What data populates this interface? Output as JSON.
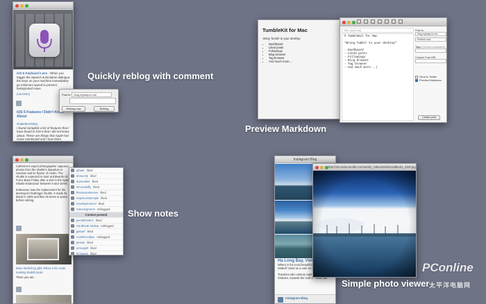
{
  "features": {
    "reblog": "Quickly reblog with comment",
    "markdown": "Preview Markdown",
    "notes": "Show notes",
    "photo": "Simple photo viewer"
  },
  "reblog_window": {
    "title": "",
    "post_text_1": "iOS 6 Keyboard Lens",
    "post_text_2": " - When you trigger the Speech & Dictation dialogue, the keys on your machine immediately go minimum speed to prevent background noise.",
    "via": "(via ishm)",
    "post2_title": "iOS 6 Features I Didn't Know About",
    "post2_author": "shakethemblog:",
    "post2_body": "I found compiled a list of features that I have found in iOS 6 that I did not know about. These are things that Apple has never mentioned and I love them.",
    "dialog": {
      "post_to_label": "Post to",
      "blog_value": "blog.myway.co.me",
      "reblog_select": "Reblog now",
      "reblog_button": "Reblog"
    }
  },
  "markdown_preview": {
    "title": "TumbleKit for Mac",
    "subtitle": "Bring Tumblr to your desktop",
    "items": [
      "Dashboard",
      "Liked posts",
      "Followings",
      "Blog browser",
      "Tag browser",
      "And much more..."
    ]
  },
  "markdown_editor": {
    "title_placeholder": "Title (optional)",
    "lines": [
      "# TumbleKit for Mac",
      "",
      "*Bring Tumblr to your desktop*",
      "",
      "- Dashboard",
      "- Liked posts",
      "- Followings",
      "- Blog browser",
      "- Tag browser",
      "- And much more...|"
    ],
    "post_to_label": "Post to",
    "blog_value": "blog.myway.co.me",
    "publish_value": "Publish now",
    "tags_label": "Tags",
    "tags_hint": "(Comma separated)",
    "url_label": "Custom Post URL",
    "send_twitter": "Send to Twitter",
    "preview_md": "Preview Markdown",
    "create_button": "Create post"
  },
  "notes_window": {
    "body_1": "Catherine's expert photographer captured photos from the shuttle's departure in Houston and its flyover of Austin. The shuttle is expected to land at Edwards Air Force Base Friday after a visit to the Space Shuttle Endeavour between 9 and 10AM.",
    "body_2": "Endeavour was the replacement for the destroyed Challenger shuttle. It made its debut in 1992 and flew 25 times in space before retiring.",
    "caption_1": "Bone Workshop gifts Yellow a fun scale, marking Reddit book!",
    "caption_2": "There you are.",
    "context_present": "Context present",
    "notes": [
      {
        "user": "gthaer",
        "action": "liked"
      },
      {
        "user": "dmsurely",
        "action": "liked"
      },
      {
        "user": "dunmarkie",
        "action": "liked"
      },
      {
        "user": "elmundotfly",
        "action": "liked"
      },
      {
        "user": "thenaturalresons",
        "action": "liked"
      },
      {
        "user": "mrpvlcuestiontyle",
        "action": "liked"
      },
      {
        "user": "newsbylemnovl",
        "action": "liked"
      },
      {
        "user": "missclegreens",
        "action": "reblogged"
      },
      {
        "user": "jacobhfosters",
        "action": "liked"
      },
      {
        "user": "mindfreak-intelpa",
        "action": "reblogged"
      },
      {
        "user": "jpsbarf",
        "action": "liked"
      },
      {
        "user": "moshineclipse",
        "action": "reblogged"
      },
      {
        "user": "jerlook",
        "action": "liked"
      },
      {
        "user": "armepjelt",
        "action": "liked"
      },
      {
        "user": "hirosagin",
        "action": "liked"
      },
      {
        "user": "farmaclones",
        "action": "liked"
      },
      {
        "user": "bbcfernant",
        "action": "liked"
      },
      {
        "user": "haleymartin",
        "action": "liked"
      }
    ]
  },
  "photo_window": {
    "title": "Instagram Blog",
    "viewer_url": "http://25.media.tumblr.com/tumblr_m9kaxm5lel1s1d6kod1_1280.jpg",
    "caption_title": "Ha Long Bay, Vietnam",
    "caption_body": "Where is the most beautiful place you've visited? Send us a note on Instagram",
    "caption_body_2": "Travelers who venture east of Hanoi, Vietnam, towards the Gulf of Tonkin will",
    "bottom_title": "Instagram Blog"
  },
  "watermark": {
    "brand": "PConline",
    "chinese": "太平洋电脑网"
  }
}
